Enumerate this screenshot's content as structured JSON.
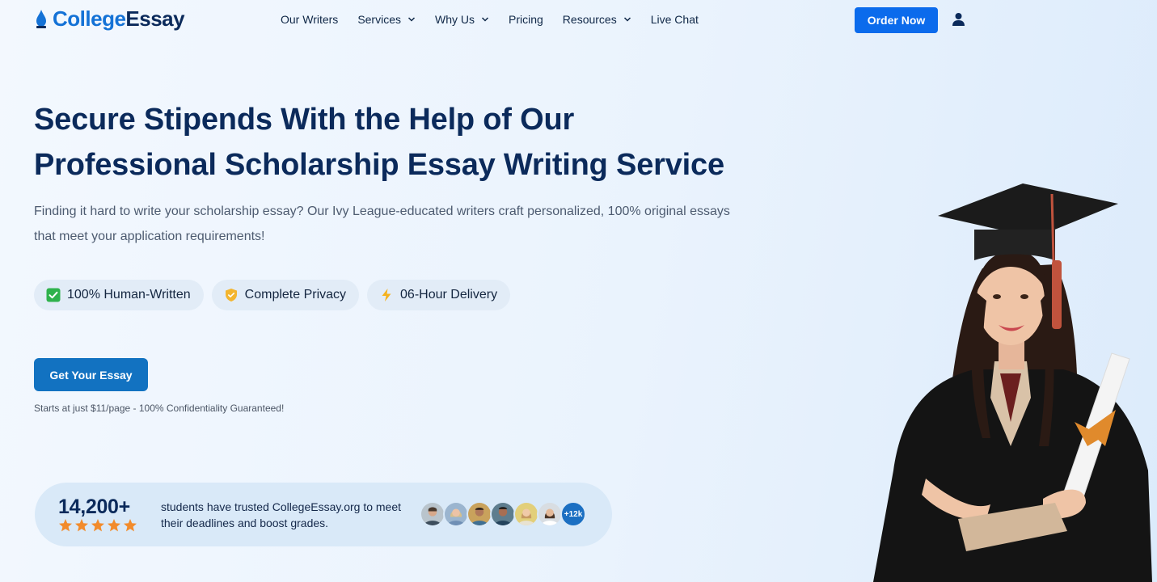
{
  "brand": {
    "logo_part1": "College",
    "logo_part2": "Essay",
    "colors": {
      "primary": "#0b6bec",
      "navy": "#0b2a5b",
      "accent_blue": "#1472d6",
      "cta": "#1272c1",
      "star": "#f28b2c"
    }
  },
  "nav": {
    "items": [
      {
        "label": "Our Writers",
        "dropdown": false
      },
      {
        "label": "Services",
        "dropdown": true
      },
      {
        "label": "Why Us",
        "dropdown": true
      },
      {
        "label": "Pricing",
        "dropdown": false
      },
      {
        "label": "Resources",
        "dropdown": true
      },
      {
        "label": "Live Chat",
        "dropdown": false
      }
    ],
    "order_button": "Order Now",
    "user_icon": "user-icon"
  },
  "hero": {
    "title_line1": "Secure Stipends With the Help of Our",
    "title_line2": "Professional Scholarship Essay Writing Service",
    "subtitle": "Finding it hard to write your scholarship essay? Our Ivy League-educated writers craft personalized, 100% original essays that meet your application requirements!",
    "badges": [
      {
        "icon": "check-icon",
        "label": "100% Human-Written"
      },
      {
        "icon": "shield-icon",
        "label": "Complete Privacy"
      },
      {
        "icon": "lightning-icon",
        "label": "06-Hour Delivery"
      }
    ],
    "cta_label": "Get Your Essay",
    "cta_note": "Starts at just $11/page - 100% Confidentiality Guaranteed!"
  },
  "trust": {
    "count": "14,200+",
    "rating_stars": 5,
    "text": "students have trusted CollegeEssay.org to meet their deadlines and boost grades.",
    "avatar_count": 6,
    "more_label": "+12k"
  }
}
